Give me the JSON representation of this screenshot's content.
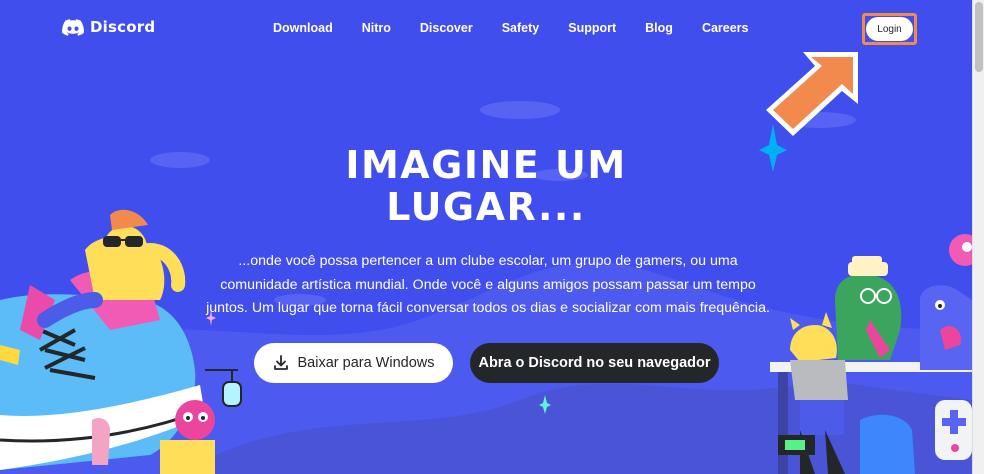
{
  "brand": {
    "name": "Discord",
    "icon": "discord-logo-icon"
  },
  "nav": {
    "links": [
      "Download",
      "Nitro",
      "Discover",
      "Safety",
      "Support",
      "Blog",
      "Careers"
    ],
    "login_label": "Login"
  },
  "hero": {
    "headline_line1": "IMAGINE UM",
    "headline_line2": "LUGAR...",
    "subtext": "...onde você possa pertencer a um clube escolar, um grupo de gamers, ou uma comunidade artística mundial. Onde você e alguns amigos possam passar um tempo juntos. Um lugar que torna fácil conversar todos os dias e socializar com mais frequência.",
    "download_label": "Baixar para Windows",
    "download_icon": "download-icon",
    "browser_label": "Abra o Discord no seu navegador"
  },
  "annotation": {
    "icon": "arrow-pointer-icon",
    "color": "#f28a4d"
  },
  "colors": {
    "background": "#404eed",
    "dark": "#23272a",
    "accent": "#f28a4d"
  }
}
